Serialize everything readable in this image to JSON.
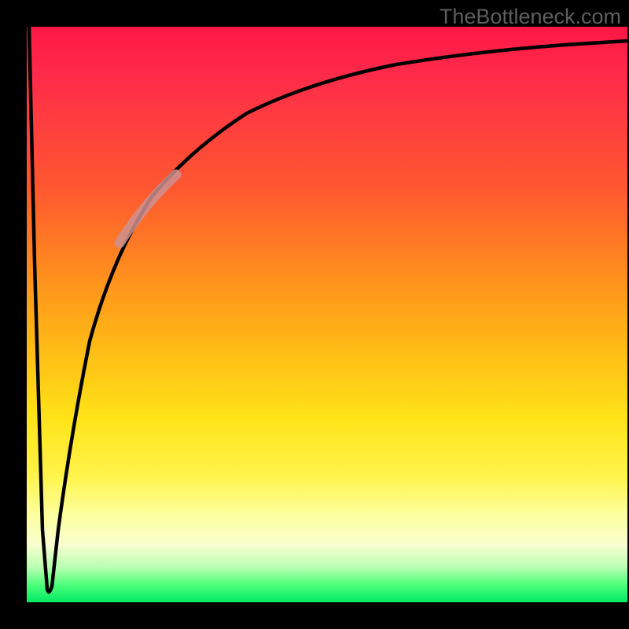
{
  "watermark": "TheBottleneck.com",
  "colors": {
    "frame": "#000000",
    "gradient_top": "#ff1744",
    "gradient_mid1": "#ff8a1e",
    "gradient_mid2": "#ffe318",
    "gradient_pale": "#fcffa0",
    "gradient_bottom": "#00e864",
    "curve": "#000000",
    "highlight": "#c98a8a"
  },
  "chart_data": {
    "type": "line",
    "title": "",
    "xlabel": "",
    "ylabel": "",
    "xlim": [
      0,
      100
    ],
    "ylim": [
      0,
      100
    ],
    "grid": false,
    "legend": false,
    "series": [
      {
        "name": "curve",
        "x": [
          0.5,
          1.5,
          3.0,
          3.5,
          4.0,
          5.0,
          7.0,
          10.0,
          14.0,
          18.0,
          22.0,
          28.0,
          35.0,
          45.0,
          60.0,
          80.0,
          100.0
        ],
        "y": [
          100,
          50,
          6,
          2,
          10,
          25,
          45,
          58,
          68,
          74,
          78,
          83,
          87,
          90,
          93,
          95,
          96
        ]
      }
    ],
    "highlight_segment": {
      "series": "curve",
      "x_range": [
        18,
        26
      ],
      "note": "pale overlay stroke on ascending part"
    }
  }
}
